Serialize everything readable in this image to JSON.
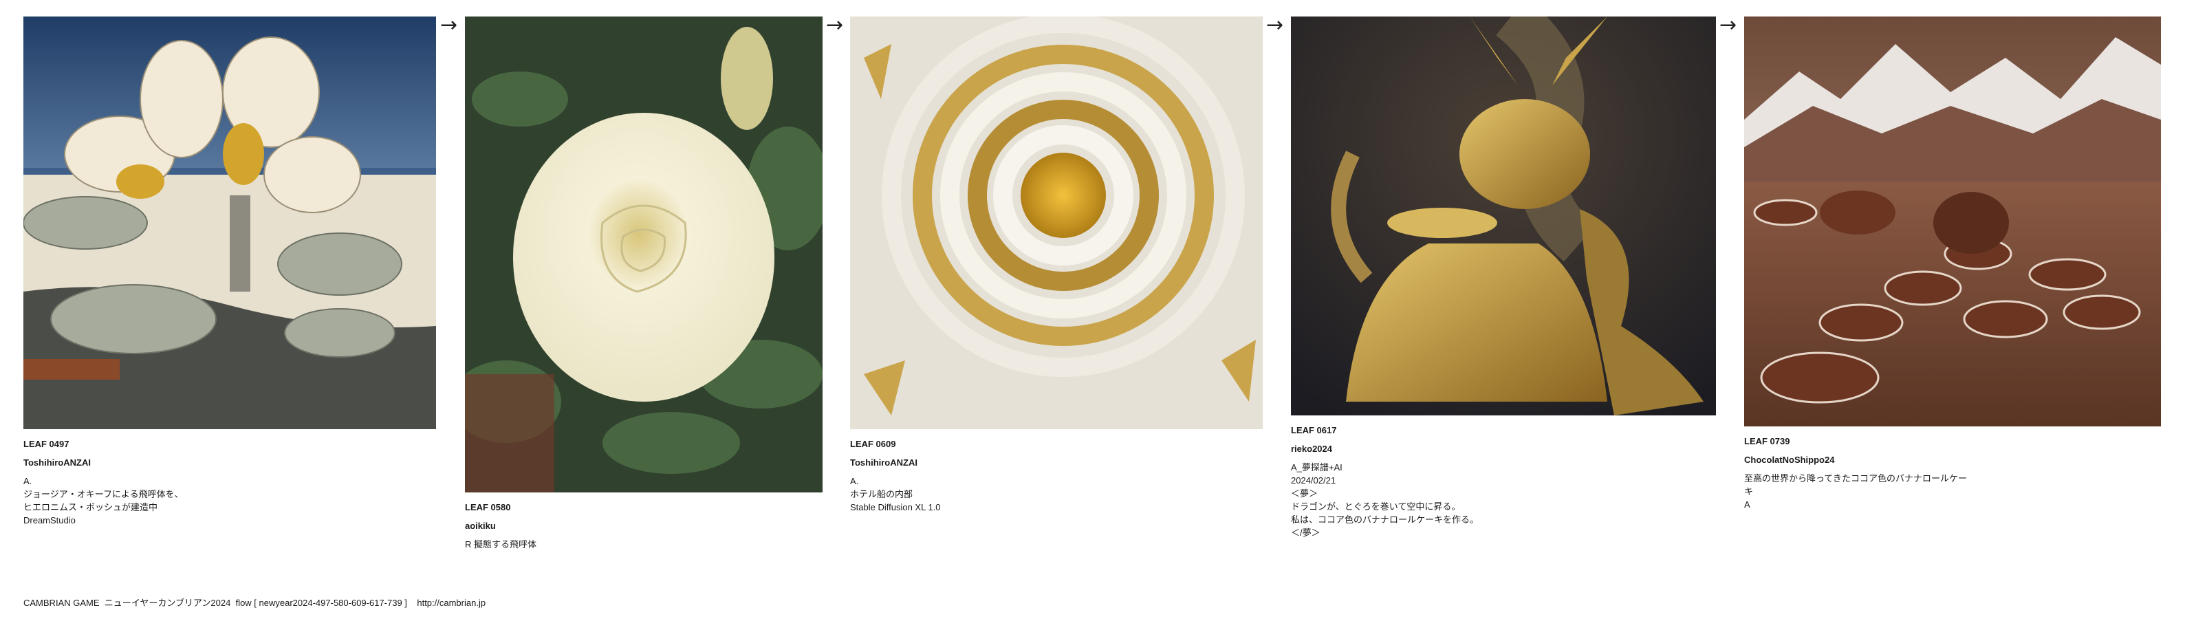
{
  "cards": [
    {
      "id": "LEAF 0497",
      "author": "ToshihiroANZAI",
      "lines": [
        "A.",
        "ジョージア・オキーフによる飛呼体を、",
        "ヒエロニムス・ボッシュが建造中",
        "DreamStudio"
      ]
    },
    {
      "id": "LEAF 0580",
      "author": "aoikiku",
      "lines": [
        "R  擬態する飛呼体"
      ]
    },
    {
      "id": "LEAF 0609",
      "author": "ToshihiroANZAI",
      "lines": [
        "A.",
        "ホテル船の内部",
        "Stable Diffusion XL 1.0"
      ]
    },
    {
      "id": "LEAF 0617",
      "author": "rieko2024",
      "lines": [
        "A_夢探譜+AI",
        "2024/02/21",
        "＜夢＞",
        "ドラゴンが、とぐろを巻いて空中に昇る。",
        "私は、ココア色のバナナロールケーキを作る。",
        "＜/夢＞"
      ]
    },
    {
      "id": "LEAF 0739",
      "author": "ChocolatNoShippo24",
      "lines": [
        "至高の世界から降ってきたココア色のバナナロールケー",
        "キ",
        "A"
      ]
    }
  ],
  "arrow_glyph": "→",
  "footer": "CAMBRIAN GAME  ニューイヤーカンブリアン2024  flow [ newyear2024-497-580-609-617-739 ]    http://cambrian.jp",
  "colors": {
    "gold": "#c9a44a",
    "cocoa": "#7a4a36",
    "cream": "#f1ead2"
  }
}
